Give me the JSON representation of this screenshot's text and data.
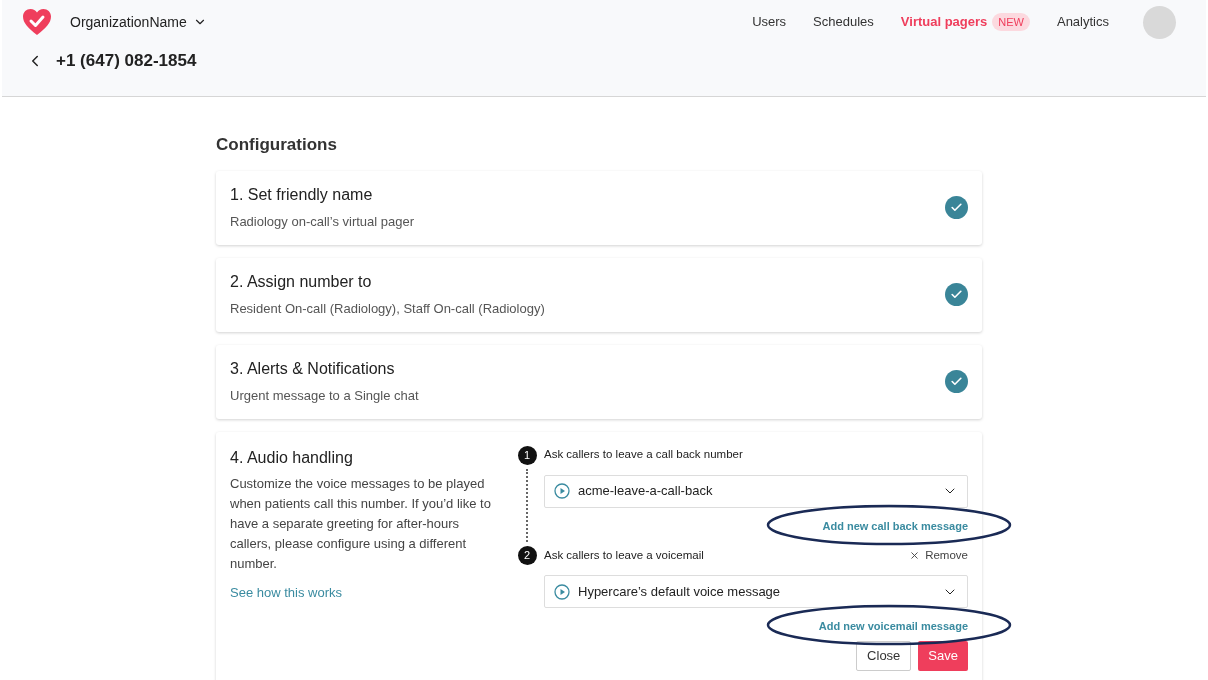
{
  "header": {
    "organization": "OrganizationName",
    "nav": [
      {
        "label": "Users",
        "selected": false
      },
      {
        "label": "Schedules",
        "selected": false
      },
      {
        "label": "Virtual pagers",
        "selected": true,
        "badge": "NEW"
      },
      {
        "label": "Analytics",
        "selected": false
      }
    ],
    "page_title": "+1 (647) 082-1854"
  },
  "section_title": "Configurations",
  "steps": [
    {
      "title": "1. Set friendly name",
      "summary": "Radiology on-call’s virtual pager",
      "completed": true
    },
    {
      "title": "2. Assign number to",
      "summary": "Resident On-call (Radiology), Staff On-call (Radiology)",
      "completed": true
    },
    {
      "title": "3. Alerts & Notifications",
      "summary": "Urgent message to a Single chat",
      "completed": true
    }
  ],
  "audio_handling": {
    "title": "4. Audio handling",
    "description": "Customize the voice messages to be played when patients call this number. If you’d like to have a separate greeting for after-hours callers, please configure using a different number.",
    "help_link": "See how this works",
    "prompts": [
      {
        "number": "1",
        "label": "Ask callers to leave a call back number",
        "value": "acme-leave-a-call-back",
        "add_link": "Add new call back message",
        "circled": true
      },
      {
        "number": "2",
        "label": "Ask callers to leave a voicemail",
        "remove": "Remove",
        "value": "Hypercare’s default voice message",
        "add_link": "Add new voicemail message",
        "circled": true
      }
    ],
    "buttons": [
      {
        "label": "Close",
        "kind": "secondary"
      },
      {
        "label": "Save",
        "kind": "primary"
      }
    ]
  }
}
